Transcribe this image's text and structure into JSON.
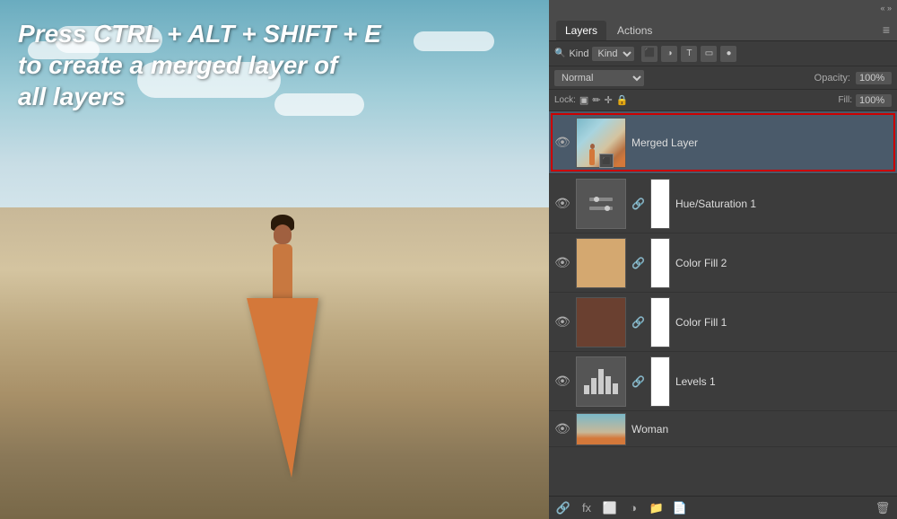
{
  "header": {
    "title": "Layers",
    "tabs": [
      "Layers",
      "Actions"
    ],
    "active_tab": "Layers",
    "menu_icon": "≡"
  },
  "resize_bar": {
    "arrows": "« »"
  },
  "filter": {
    "kind_label": "Kind",
    "dropdown_value": "Kind",
    "icons": [
      "pixel",
      "adjustment",
      "type",
      "shape",
      "smart-object"
    ]
  },
  "blend": {
    "mode": "Normal",
    "opacity_label": "Opacity:",
    "opacity_value": "100%"
  },
  "lock": {
    "label": "Lock:",
    "fill_label": "Fill:",
    "fill_value": "100%"
  },
  "layers": [
    {
      "name": "Merged Layer",
      "type": "image",
      "visible": true,
      "selected": true,
      "highlighted": true,
      "visibility_icon": "👁"
    },
    {
      "name": "Hue/Saturation 1",
      "type": "adjustment",
      "visible": true,
      "selected": false,
      "visibility_icon": "👁"
    },
    {
      "name": "Color Fill 2",
      "type": "fill",
      "visible": true,
      "selected": false,
      "visibility_icon": "👁"
    },
    {
      "name": "Color Fill 1",
      "type": "fill",
      "visible": true,
      "selected": false,
      "visibility_icon": "👁"
    },
    {
      "name": "Levels 1",
      "type": "adjustment",
      "visible": true,
      "selected": false,
      "visibility_icon": "👁"
    },
    {
      "name": "Woman",
      "type": "image",
      "visible": true,
      "selected": false,
      "visibility_icon": "👁"
    }
  ],
  "toolbar": {
    "icons": [
      "link",
      "fx",
      "mask",
      "adjustment",
      "group",
      "new-layer",
      "delete"
    ]
  },
  "overlay_text": {
    "line1": "Press CTRL + ALT + SHIFT + E",
    "line2": "to create a merged layer of",
    "line3": "all layers"
  }
}
